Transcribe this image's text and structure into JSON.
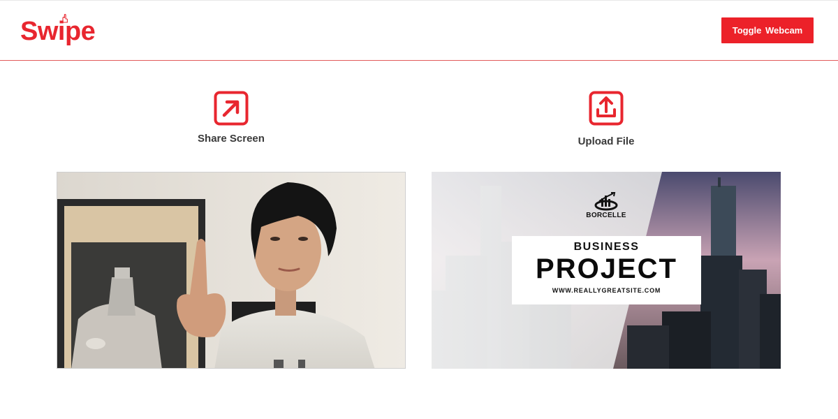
{
  "app": {
    "name": "Swipe",
    "brand_color": "#e8262f"
  },
  "header": {
    "toggle_label": "Toggle  Webcam"
  },
  "actions": [
    {
      "label": "Share Screen",
      "icon": "arrow-up-right-icon"
    },
    {
      "label": "Upload File",
      "icon": "upload-icon"
    }
  ],
  "file_preview": {
    "brand": "BORCELLE",
    "subtitle": "BUSINESS",
    "title": "PROJECT",
    "url": "WWW.REALLYGREATSITE.COM"
  }
}
